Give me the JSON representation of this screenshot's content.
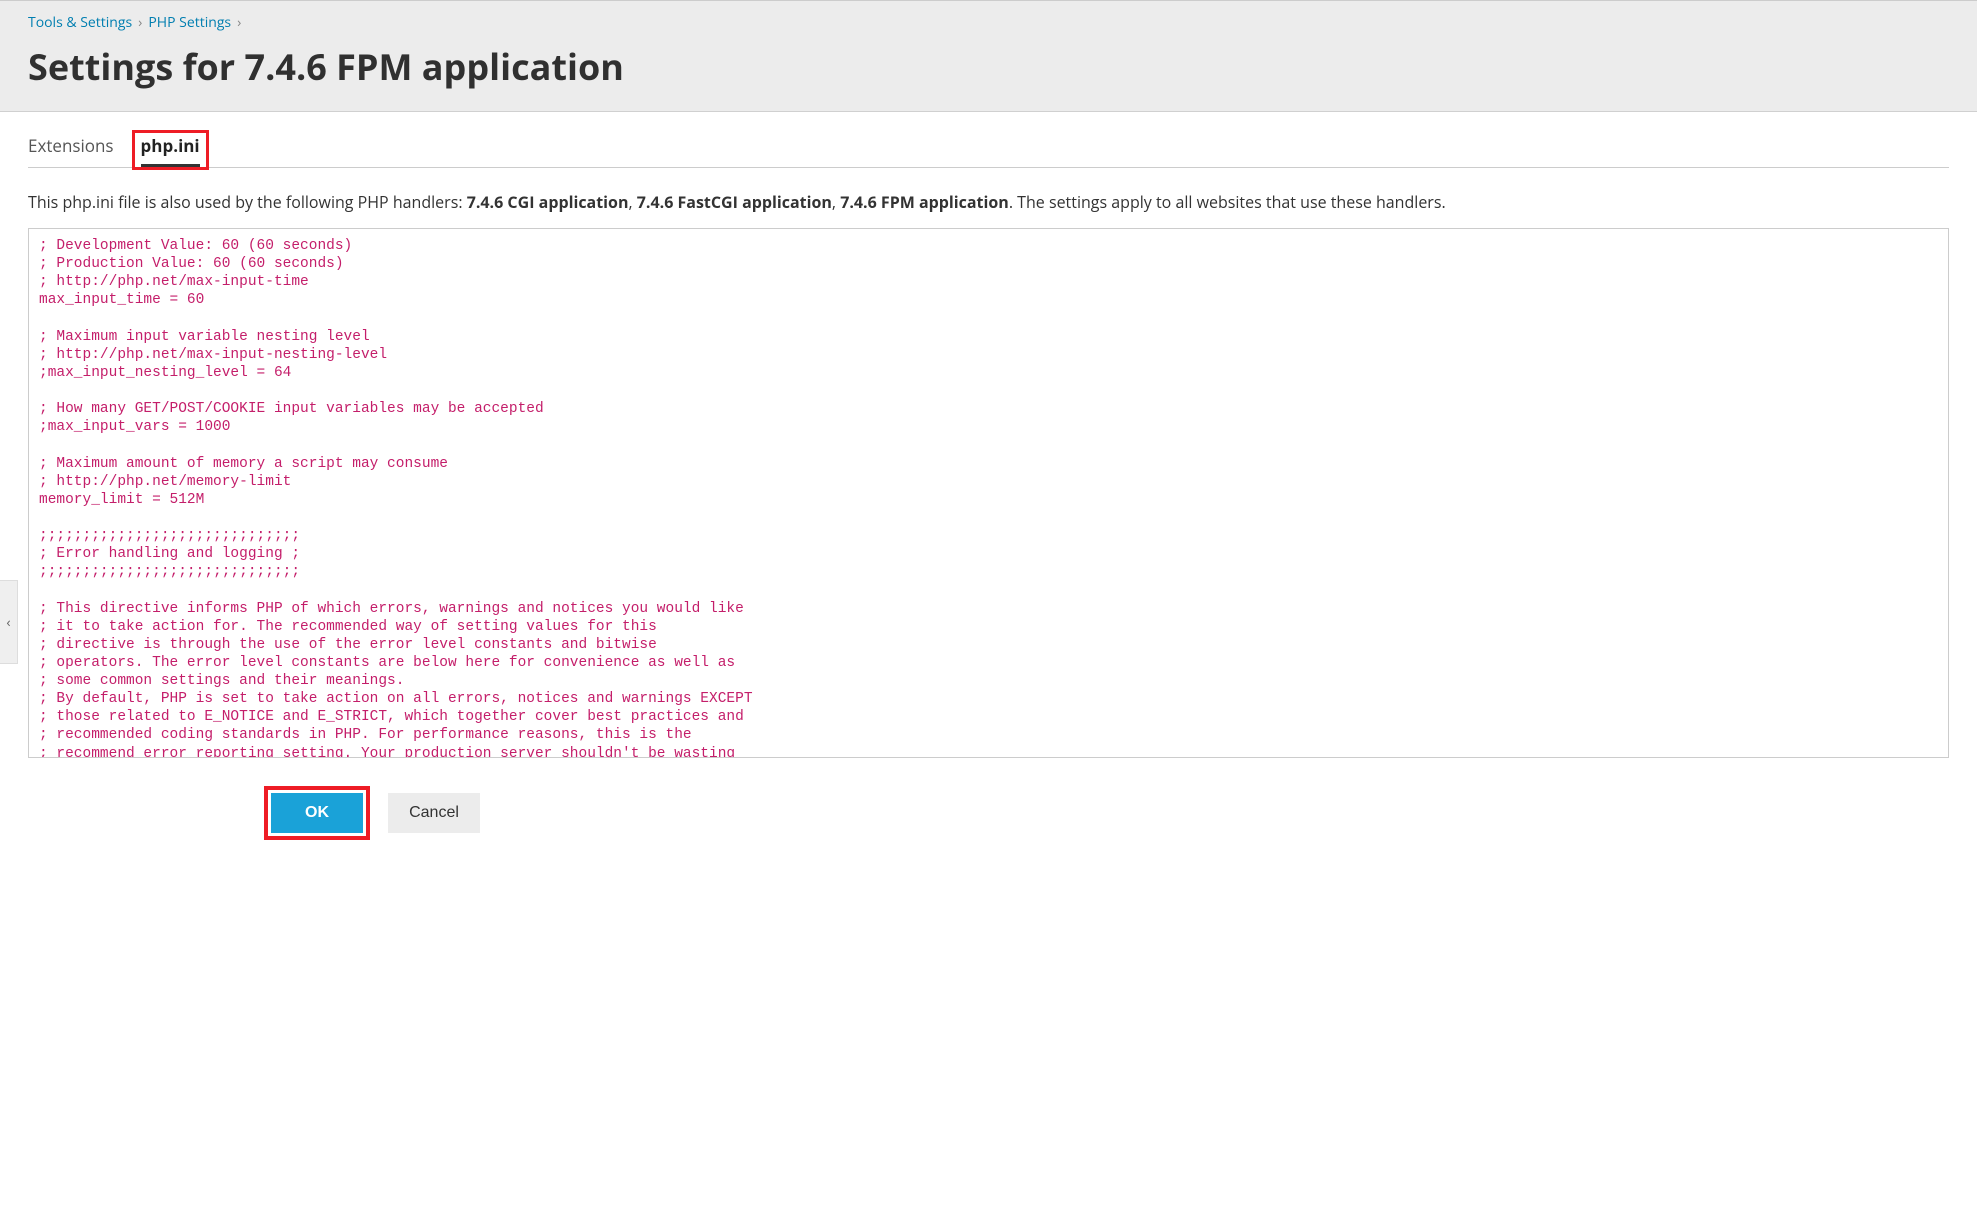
{
  "breadcrumb": {
    "item1": "Tools & Settings",
    "item2": "PHP Settings"
  },
  "page_title": "Settings for 7.4.6 FPM application",
  "tabs": {
    "extensions": "Extensions",
    "phpini": "php.ini"
  },
  "info": {
    "prefix": "This php.ini file is also used by the following PHP handlers: ",
    "h1": "7.4.6 CGI application",
    "h2": "7.4.6 FastCGI application",
    "h3": "7.4.6 FPM application",
    "suffix": ". The settings apply to all websites that use these handlers."
  },
  "editor_content": "; Development Value: 60 (60 seconds)\n; Production Value: 60 (60 seconds)\n; http://php.net/max-input-time\nmax_input_time = 60\n\n; Maximum input variable nesting level\n; http://php.net/max-input-nesting-level\n;max_input_nesting_level = 64\n\n; How many GET/POST/COOKIE input variables may be accepted\n;max_input_vars = 1000\n\n; Maximum amount of memory a script may consume\n; http://php.net/memory-limit\nmemory_limit = 512M\n\n;;;;;;;;;;;;;;;;;;;;;;;;;;;;;;\n; Error handling and logging ;\n;;;;;;;;;;;;;;;;;;;;;;;;;;;;;;\n\n; This directive informs PHP of which errors, warnings and notices you would like\n; it to take action for. The recommended way of setting values for this\n; directive is through the use of the error level constants and bitwise\n; operators. The error level constants are below here for convenience as well as\n; some common settings and their meanings.\n; By default, PHP is set to take action on all errors, notices and warnings EXCEPT\n; those related to E_NOTICE and E_STRICT, which together cover best practices and\n; recommended coding standards in PHP. For performance reasons, this is the\n; recommend error reporting setting. Your production server shouldn't be wasting",
  "buttons": {
    "ok": "OK",
    "cancel": "Cancel"
  }
}
